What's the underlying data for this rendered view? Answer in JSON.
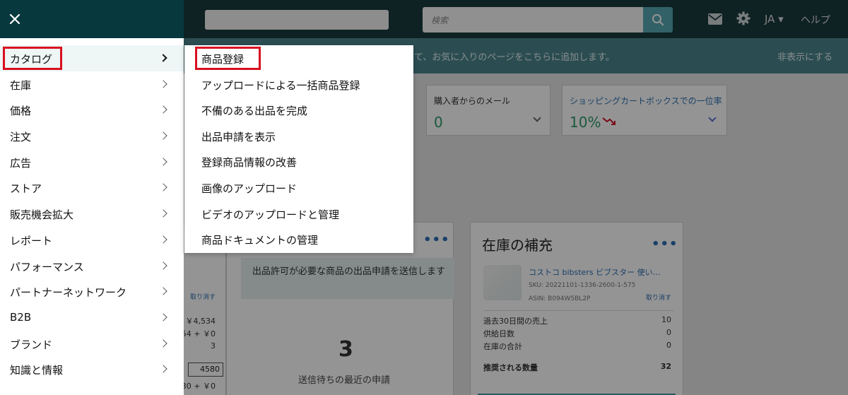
{
  "background": {
    "search_placeholder": "検索",
    "language": "JA ▾",
    "help": "ヘルプ",
    "banner_text": "て、お気に入りのページをこちらに追加します。",
    "banner_hide": "非表示にする",
    "metric_buyer_mail": {
      "title": "購入者からのメール",
      "value": "0"
    },
    "metric_cart_box": {
      "title": "ショッピングカートボックスでの一位率",
      "value": "10%"
    },
    "approval_card": {
      "notice": "出品許可が必要な商品の出品申請を送信します",
      "count": "3",
      "caption": "送信待ちの最近の申請"
    },
    "restock_card": {
      "title": "在庫の補充",
      "product_name": "コストコ bibsters ビブスター 使い…",
      "sku": "SKU: 20221101-1336-2600-1-575",
      "asin": "ASIN: B094W5BL2P",
      "undo": "取り消す",
      "stats": [
        {
          "label": "過去30日間の売上",
          "value": "10"
        },
        {
          "label": "供給日数",
          "value": "0"
        },
        {
          "label": "在庫の合計",
          "value": "0"
        },
        {
          "label": "推奨される数量",
          "value": "32"
        }
      ]
    },
    "left_partial": {
      "undo": "取り消す",
      "line1": "￥4,534",
      "line2": "54 + ￥0",
      "line3": "3",
      "box_value": "4580",
      "line4": "30 + ￥0"
    }
  },
  "sidebar": {
    "items": [
      {
        "label": "カタログ"
      },
      {
        "label": "在庫"
      },
      {
        "label": "価格"
      },
      {
        "label": "注文"
      },
      {
        "label": "広告"
      },
      {
        "label": "ストア"
      },
      {
        "label": "販売機会拡大"
      },
      {
        "label": "レポート"
      },
      {
        "label": "パフォーマンス"
      },
      {
        "label": "パートナーネットワーク"
      },
      {
        "label": "B2B"
      },
      {
        "label": "ブランド"
      },
      {
        "label": "知識と情報"
      }
    ]
  },
  "submenu": {
    "items": [
      {
        "label": "商品登録"
      },
      {
        "label": "アップロードによる一括商品登録"
      },
      {
        "label": "不備のある出品を完成"
      },
      {
        "label": "出品申請を表示"
      },
      {
        "label": "登録商品情報の改善"
      },
      {
        "label": "画像のアップロード"
      },
      {
        "label": "ビデオのアップロードと管理"
      },
      {
        "label": "商品ドキュメントの管理"
      }
    ]
  },
  "colors": {
    "header": "#07383d",
    "highlight": "#d80f1f",
    "banner": "#4b868d",
    "accent": "#57a7b3"
  }
}
